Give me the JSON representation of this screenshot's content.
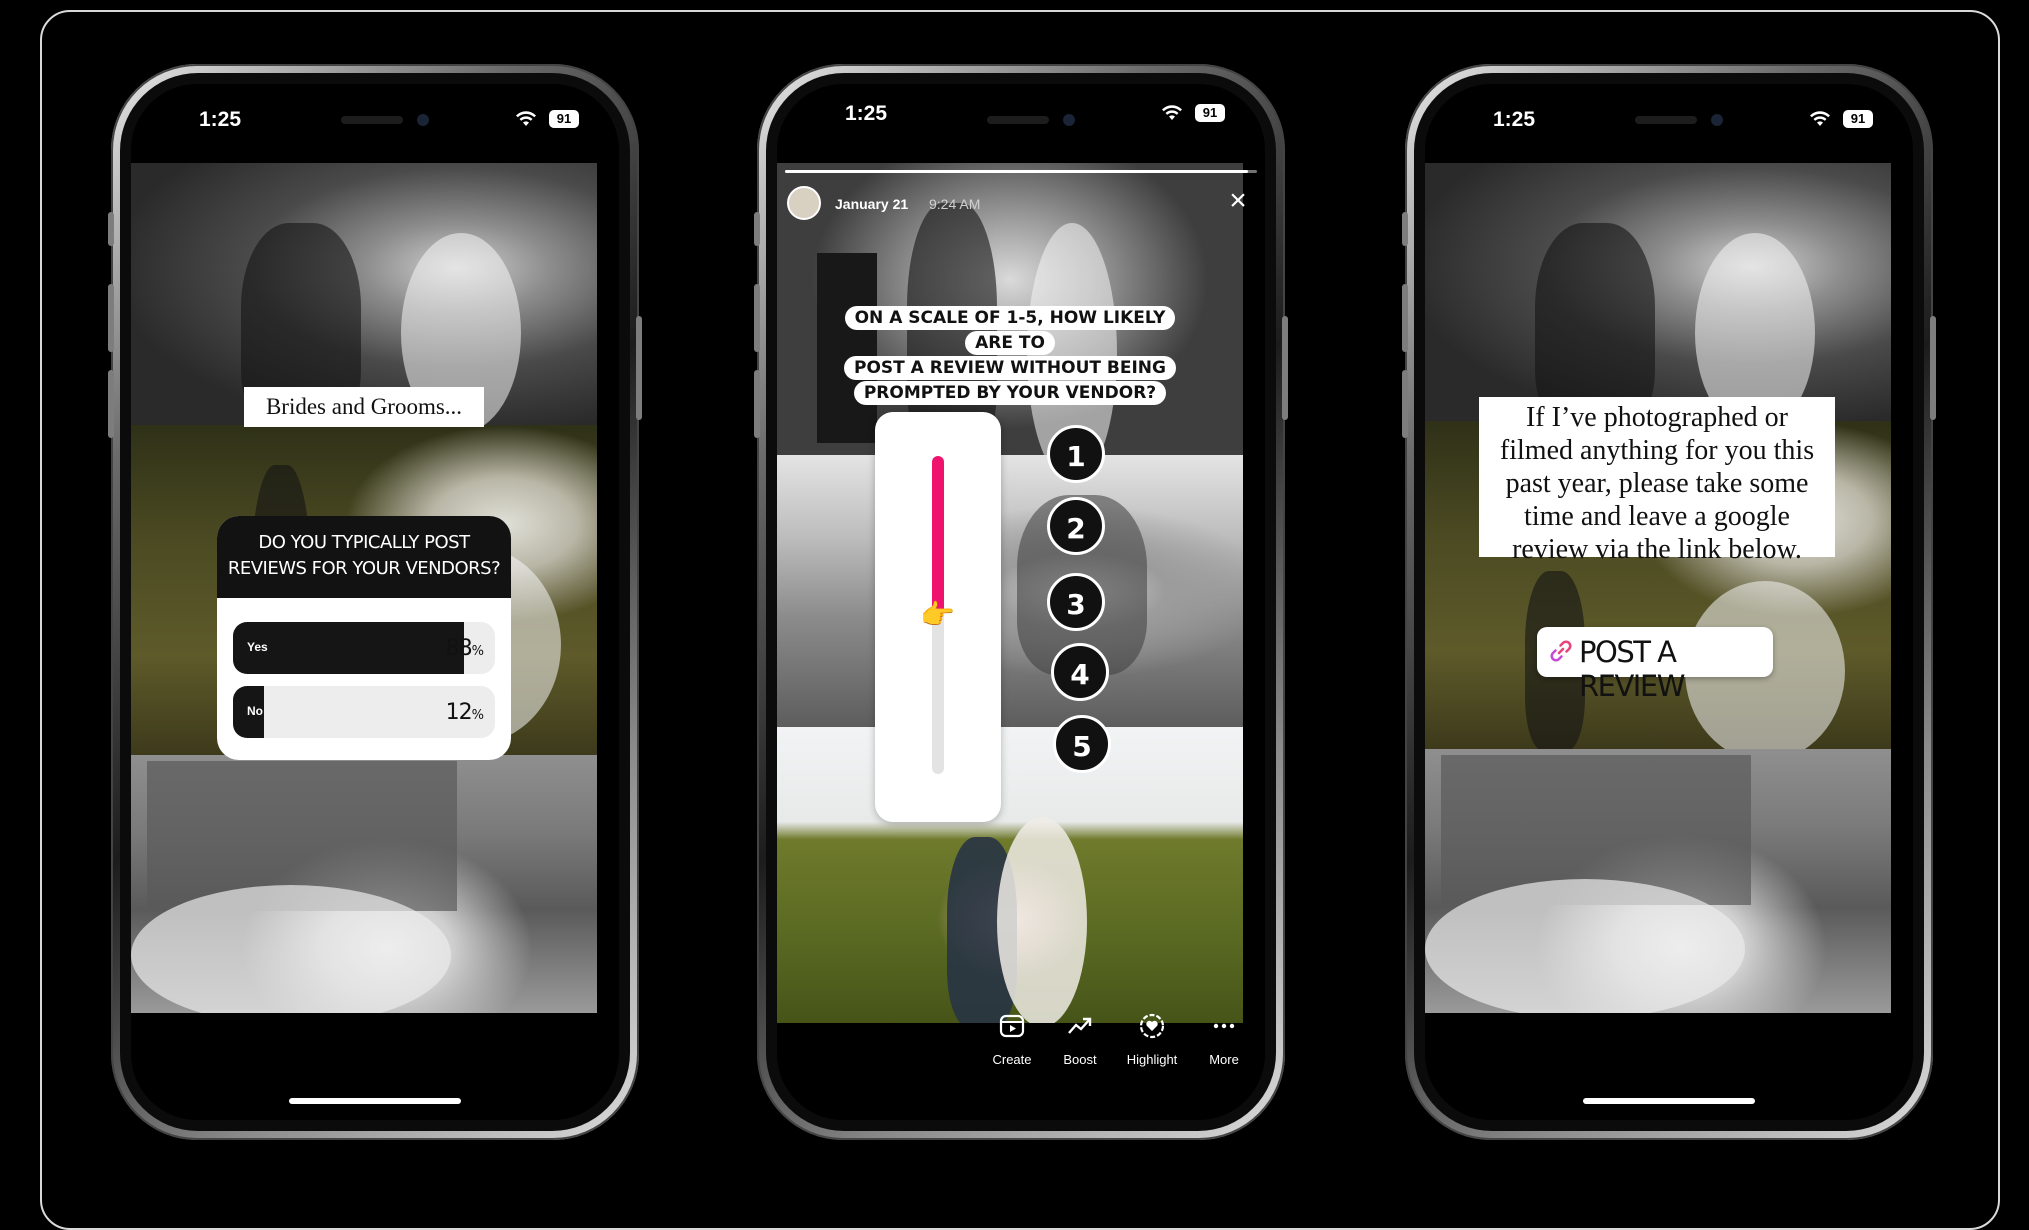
{
  "status_bar": {
    "time": "1:25",
    "time_phone2": "1:25",
    "battery": "91"
  },
  "phone1": {
    "label": "Brides and Grooms...",
    "poll": {
      "question_line1": "DO YOU TYPICALLY POST",
      "question_line2": "REVIEWS FOR YOUR VENDORS?",
      "options": [
        {
          "label": "Yes",
          "percent": "88",
          "fraction": 0.88
        },
        {
          "label": "No",
          "percent": "12",
          "fraction": 0.12
        }
      ],
      "percent_sign": "%"
    }
  },
  "phone2": {
    "story_progress": 0.98,
    "date": "January 21",
    "time": "9:24 AM",
    "close_icon": "×",
    "question_line1": "ON A SCALE OF 1-5, HOW LIKELY ARE TO",
    "question_line2": "POST A REVIEW WITHOUT BEING",
    "question_line3": "PROMPTED BY YOUR VENDOR?",
    "slider_value": 0.5,
    "slider_emoji": "👉",
    "slider_color": "#f0136e",
    "numbers": [
      "1",
      "2",
      "3",
      "4",
      "5"
    ],
    "owner_actions": [
      {
        "label": "Create",
        "icon": "create-icon"
      },
      {
        "label": "Boost",
        "icon": "boost-icon"
      },
      {
        "label": "Highlight",
        "icon": "highlight-icon"
      },
      {
        "label": "More",
        "icon": "more-icon"
      }
    ]
  },
  "phone3": {
    "message_line1": "If I’ve photographed or",
    "message_line2": "filmed anything for you this",
    "message_line3": "past year, please take some",
    "message_line4": "time and leave a google",
    "message_line5": "review via the link below.",
    "link_label": "POST A REVIEW",
    "link_color": "#e8457a"
  }
}
